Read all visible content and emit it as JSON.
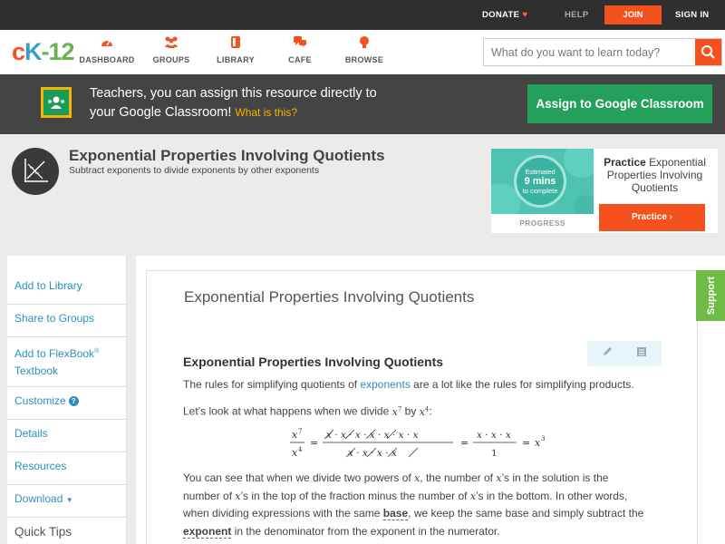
{
  "topbar": {
    "donate": "DONATE",
    "help": "HELP",
    "join": "JOIN",
    "signin": "SIGN IN"
  },
  "logo": {
    "c": "c",
    "k": "K",
    "n": "-12"
  },
  "nav": [
    {
      "label": "DASHBOARD",
      "icon": "gauge-icon"
    },
    {
      "label": "GROUPS",
      "icon": "people-icon"
    },
    {
      "label": "LIBRARY",
      "icon": "book-icon"
    },
    {
      "label": "CAFE",
      "icon": "chat-bubbles-icon"
    },
    {
      "label": "BROWSE",
      "icon": "lightbulb-icon"
    }
  ],
  "search": {
    "placeholder": "What do you want to learn today?"
  },
  "classroom": {
    "line1": "Teachers, you can assign this resource directly to",
    "line2": "your Google Classroom!",
    "what": "What is this?",
    "button": "Assign to Google Classroom"
  },
  "page": {
    "title": "Exponential Properties Involving Quotients",
    "subtitle": "Subtract exponents to divide exponents by other exponents"
  },
  "practice": {
    "estimated": "Estimated",
    "mins": "9 mins",
    "complete": "to complete",
    "progress": "PROGRESS",
    "title_bold": "Practice",
    "title_rest": "Exponential Properties Involving Quotients",
    "button": "Practice"
  },
  "sidebar": {
    "items": [
      {
        "label": "Add to Library"
      },
      {
        "label": "Share to Groups"
      },
      {
        "label": "Add to FlexBook"
      },
      {
        "label": "Textbook"
      },
      {
        "label": "Customize"
      },
      {
        "label": "Details"
      },
      {
        "label": "Resources"
      },
      {
        "label": "Download"
      }
    ],
    "registered": "®",
    "quick_tips": "Quick Tips"
  },
  "article": {
    "title": "Exponential Properties Involving Quotients",
    "heading": "Exponential Properties Involving Quotients",
    "p1_a": "The rules for simplifying quotients of",
    "p1_link": "exponents",
    "p1_b": "are a lot like the rules for simplifying products.",
    "p2_a": "Let’s look at what happens when we divide",
    "p2_b": "by",
    "p3_a": "You can see that when we divide two powers of",
    "p3_b": ", the number of",
    "p3_c": "’s in the solution is the",
    "p4_a": "number of",
    "p4_b": "’s in the top of the fraction minus the number of",
    "p4_c": "’s in the bottom. In other words,",
    "p5_a": "when dividing expressions with the same",
    "p5_base": "base",
    "p5_b": ", we keep the same base and simply subtract the",
    "p6_exp": "exponent",
    "p6_b": "in the denominator from the exponent in the numerator."
  },
  "support": "Support",
  "colors": {
    "accent": "#f4511e",
    "link": "#2a8fbd",
    "classroom_green": "#25a05a",
    "support_green": "#6fbb45",
    "dark_bar": "#2f2f2f"
  }
}
